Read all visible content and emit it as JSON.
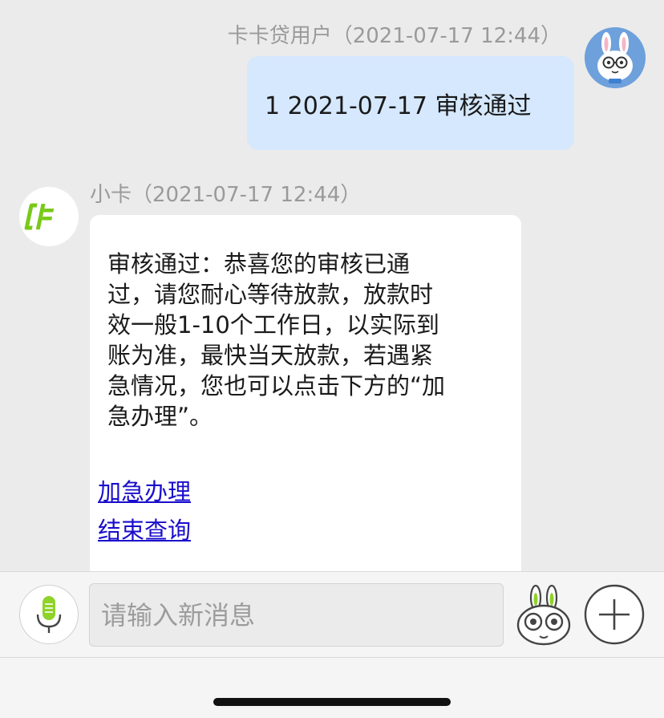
{
  "outgoing_message": {
    "sender_meta": "卡卡贷用户（2021-07-17 12:44）",
    "text": "1 2021-07-17 审核通过",
    "avatar_icon": "rabbit-avatar-icon"
  },
  "incoming_message": {
    "sender_meta": "小卡（2021-07-17 12:44）",
    "lines": [
      "审核通过：恭喜您的审核已通",
      "过，请您耐心等待放款，放款时",
      "效一般1-10个工作日，以实际到",
      "账为准，最快当天放款，若遇紧",
      "急情况，您也可以点击下方的“加",
      "急办理”。"
    ],
    "links": [
      "加急办理",
      "结束查询"
    ],
    "avatar_icon": "kaka-logo-icon"
  },
  "input_bar": {
    "placeholder": "请输入新消息",
    "value": "",
    "mic_icon": "microphone-icon",
    "sticker_icon": "rabbit-sticker-icon",
    "plus_icon": "plus-icon"
  },
  "colors": {
    "outgoing_bubble": "#d5e8fd",
    "incoming_bubble": "#ffffff",
    "link": "#1a0dcc",
    "logo_green": "#7ac91a",
    "meta_text": "#9a9a9a"
  }
}
